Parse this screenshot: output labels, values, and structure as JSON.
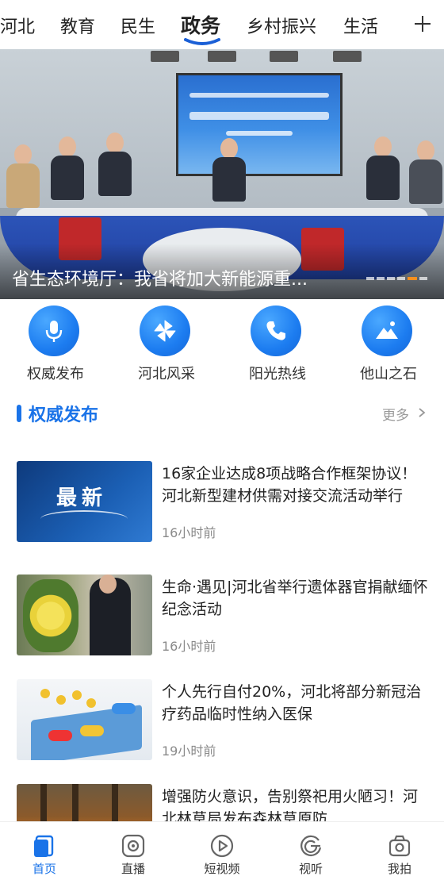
{
  "top_tabs": [
    {
      "label": "河北"
    },
    {
      "label": "教育"
    },
    {
      "label": "民生"
    },
    {
      "label": "政务",
      "active": true
    },
    {
      "label": "乡村振兴"
    },
    {
      "label": "生活"
    }
  ],
  "banner": {
    "caption": "省生态环境厅：我省将加大新能源重...",
    "slide_count": 6,
    "active_slide": 5
  },
  "quick_links": [
    {
      "label": "权威发布",
      "icon": "microphone-icon"
    },
    {
      "label": "河北风采",
      "icon": "pinwheel-icon"
    },
    {
      "label": "阳光热线",
      "icon": "phone-icon"
    },
    {
      "label": "他山之石",
      "icon": "mountain-icon"
    }
  ],
  "section": {
    "title": "权威发布",
    "more_label": "更多"
  },
  "news": [
    {
      "title": "16家企业达成8项战略合作框架协议！河北新型建材供需对接交流活动举行",
      "time": "16小时前",
      "thumb_text": "最新"
    },
    {
      "title": "生命·遇见|河北省举行遗体器官捐献缅怀纪念活动",
      "time": "16小时前"
    },
    {
      "title": "个人先行自付20%，河北将部分新冠治疗药品临时性纳入医保",
      "time": "19小时前"
    },
    {
      "title": "增强防火意识，告别祭祀用火陋习！河北林草局发布森林草原防",
      "time": ""
    }
  ],
  "bottom_nav": [
    {
      "label": "首页",
      "icon": "home-icon",
      "active": true
    },
    {
      "label": "直播",
      "icon": "live-icon"
    },
    {
      "label": "短视频",
      "icon": "short-video-icon"
    },
    {
      "label": "视听",
      "icon": "audio-visual-icon"
    },
    {
      "label": "我拍",
      "icon": "camera-icon"
    }
  ],
  "colors": {
    "accent": "#1a73e8",
    "slide_indicator": "#f7901e"
  }
}
